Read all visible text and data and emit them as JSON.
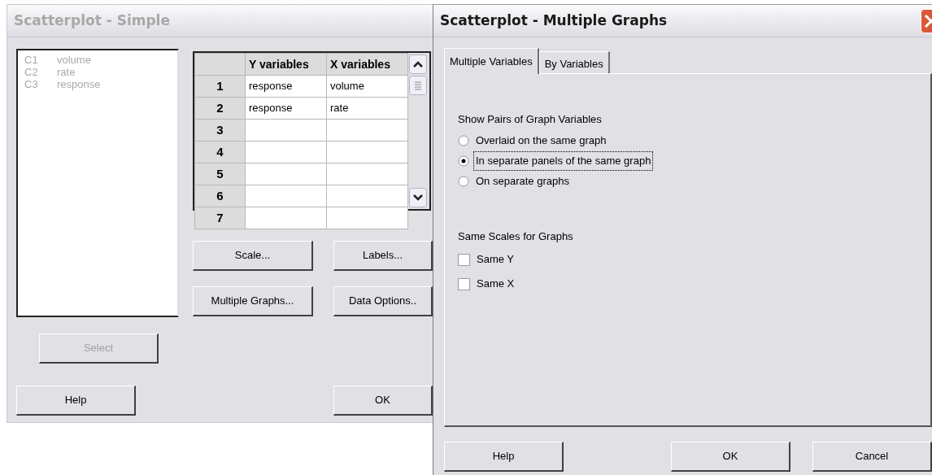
{
  "left_window": {
    "title": "Scatterplot - Simple",
    "active": false,
    "variables": [
      {
        "column": "C1",
        "name": "volume"
      },
      {
        "column": "C2",
        "name": "rate"
      },
      {
        "column": "C3",
        "name": "response"
      }
    ],
    "variables_disabled": true,
    "grid": {
      "columns": [
        "Y variables",
        "X variables"
      ],
      "rows": [
        {
          "number": "1",
          "cells": [
            "response",
            "volume"
          ]
        },
        {
          "number": "2",
          "cells": [
            "response",
            "rate"
          ]
        },
        {
          "number": "3",
          "cells": [
            "",
            ""
          ]
        },
        {
          "number": "4",
          "cells": [
            "",
            ""
          ]
        },
        {
          "number": "5",
          "cells": [
            "",
            ""
          ]
        },
        {
          "number": "6",
          "cells": [
            "",
            ""
          ]
        },
        {
          "number": "7",
          "cells": [
            "",
            ""
          ]
        }
      ]
    },
    "option_buttons": [
      {
        "label": "Scale..."
      },
      {
        "label": "Labels..."
      },
      {
        "label": "Multiple Graphs..."
      },
      {
        "label": "Data Options.."
      }
    ],
    "select_button": {
      "label": "Select",
      "disabled": true
    },
    "help_button": {
      "label": "Help"
    },
    "ok_button": {
      "label": "OK"
    }
  },
  "right_window": {
    "title": "Scatterplot - Multiple Graphs",
    "active": true,
    "tabs": [
      {
        "label": "Multiple Variables",
        "selected": true
      },
      {
        "label": "By Variables",
        "selected": false
      }
    ],
    "pairs_heading": "Show Pairs of Graph Variables",
    "pairs_options": [
      {
        "label": "Overlaid on the same graph",
        "selected": false
      },
      {
        "label": "In separate panels of the same graph",
        "selected": true
      },
      {
        "label": "On separate graphs",
        "selected": false
      }
    ],
    "scales_heading": "Same Scales for Graphs",
    "scales_options": [
      {
        "label": "Same Y",
        "checked": false
      },
      {
        "label": "Same X",
        "checked": false
      }
    ],
    "buttons": [
      {
        "label": "Help"
      },
      {
        "label": "OK"
      },
      {
        "label": "Cancel"
      }
    ]
  }
}
